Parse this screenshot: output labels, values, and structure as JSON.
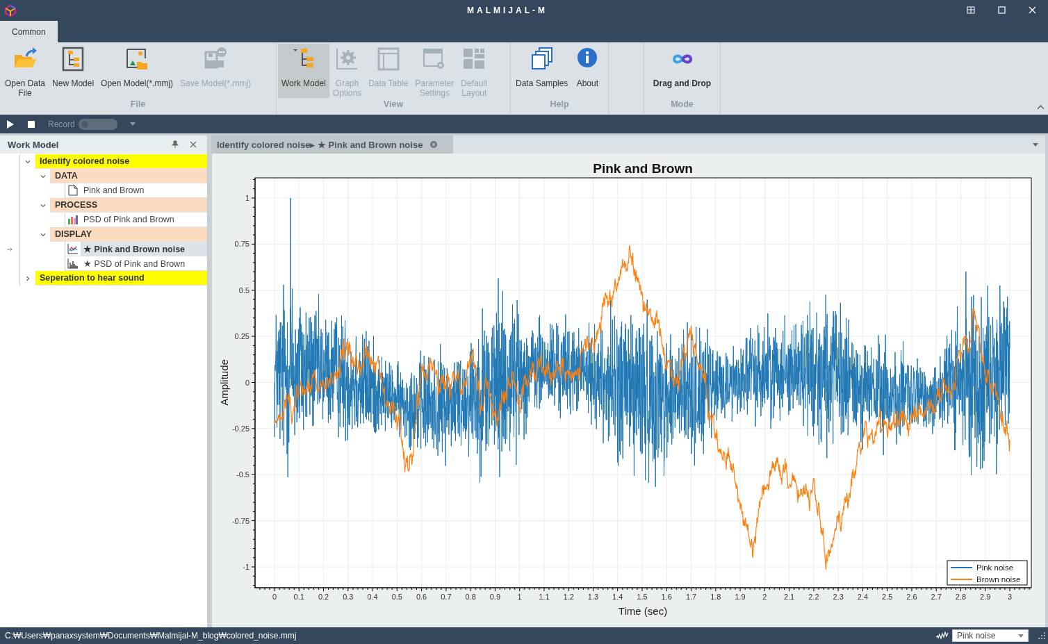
{
  "window": {
    "title": "MALMIJAL-M"
  },
  "ribbon": {
    "tabs": [
      {
        "label": "Common",
        "selected": true
      }
    ],
    "groups": [
      {
        "label": "File",
        "buttons": [
          {
            "label": "Open Data\nFile",
            "disabled": false,
            "selected": false
          },
          {
            "label": "New Model",
            "disabled": false,
            "selected": false
          },
          {
            "label": "Open Model(*.mmj)",
            "disabled": false,
            "selected": false
          },
          {
            "label": "Save Model(*.mmj)",
            "disabled": true,
            "selected": false
          }
        ]
      },
      {
        "label": "View",
        "buttons": [
          {
            "label": "Work Model",
            "disabled": false,
            "selected": true
          },
          {
            "label": "Graph\nOptions",
            "disabled": true,
            "selected": false
          },
          {
            "label": "Data Table",
            "disabled": true,
            "selected": false
          },
          {
            "label": "Parameter\nSettings",
            "disabled": true,
            "selected": false
          },
          {
            "label": "Default\nLayout",
            "disabled": true,
            "selected": false
          }
        ]
      },
      {
        "label": "Help",
        "buttons": [
          {
            "label": "Data Samples",
            "disabled": false,
            "selected": false
          },
          {
            "label": "About",
            "disabled": false,
            "selected": false
          }
        ]
      },
      {
        "label": "Mode",
        "buttons": [
          {
            "label": "Drag and Drop",
            "disabled": false,
            "selected": false
          }
        ]
      }
    ]
  },
  "toolbar": {
    "record": {
      "label": "Record",
      "on": false
    }
  },
  "work_model": {
    "title": "Work Model",
    "tree": [
      {
        "label": "Identify colored noise",
        "kind": "group",
        "expanded": true,
        "selected": false,
        "children": [
          {
            "label": "DATA",
            "kind": "category",
            "expanded": true,
            "selected": false,
            "children": [
              {
                "label": "Pink and Brown",
                "kind": "data",
                "selected": false
              }
            ]
          },
          {
            "label": "PROCESS",
            "kind": "category",
            "expanded": true,
            "selected": false,
            "children": [
              {
                "label": "PSD of Pink and Brown",
                "kind": "process",
                "selected": false
              }
            ]
          },
          {
            "label": "DISPLAY",
            "kind": "category",
            "expanded": true,
            "selected": false,
            "children": [
              {
                "label": "★ Pink and Brown noise",
                "kind": "line-plot",
                "selected": true
              },
              {
                "label": "★ PSD of Pink and Brown",
                "kind": "bar-plot",
                "selected": false
              }
            ]
          }
        ]
      },
      {
        "label": "Seperation to hear sound",
        "kind": "group",
        "expanded": false,
        "selected": false
      }
    ]
  },
  "document": {
    "tab": {
      "label": "Identify colored noise▸ ★ Pink and Brown noise",
      "selected": true
    },
    "chart": {
      "title": "Pink and Brown",
      "xlabel": "Time (sec)",
      "ylabel": "Amplitude",
      "xticks": [
        "0",
        "0.1",
        "0.2",
        "0.3",
        "0.4",
        "0.5",
        "0.6",
        "0.7",
        "0.8",
        "0.9",
        "1",
        "1.1",
        "1.2",
        "1.3",
        "1.4",
        "1.5",
        "1.6",
        "1.7",
        "1.8",
        "1.9",
        "2",
        "2.1",
        "2.2",
        "2.3",
        "2.4",
        "2.5",
        "2.6",
        "2.7",
        "2.8",
        "2.9",
        "3"
      ],
      "yticks": [
        "1",
        "0.75",
        "0.5",
        "0.25",
        "0",
        "-0.25",
        "-0.5",
        "-0.75",
        "-1"
      ],
      "legend": [
        {
          "name": "Pink noise",
          "color": "#1f77b4"
        },
        {
          "name": "Brown noise",
          "color": "#ff7f0e"
        }
      ]
    }
  },
  "status_bar": {
    "path": "C:₩Users₩panaxsystem₩Documents₩Malmijal-M_blog₩colored_noise.mmj",
    "series": "Pink noise"
  }
}
